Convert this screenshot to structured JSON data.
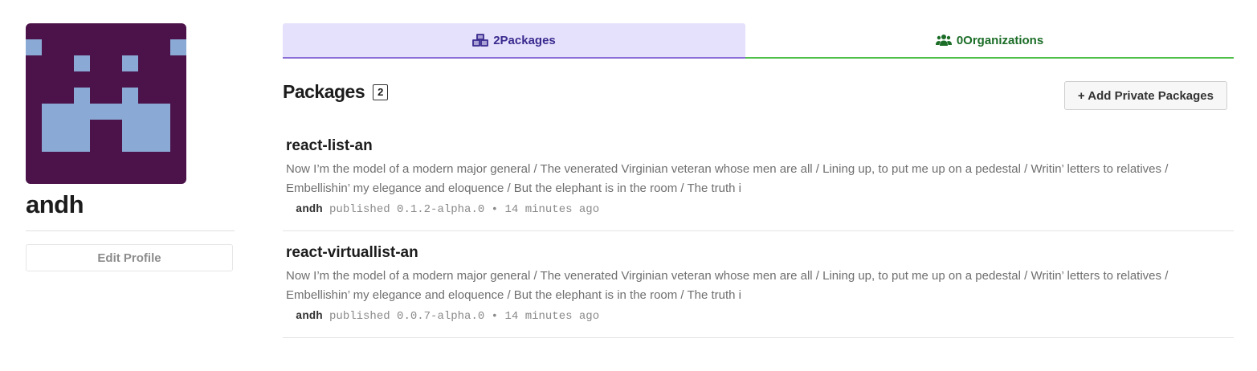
{
  "profile": {
    "username": "andh",
    "edit_label": "Edit Profile",
    "avatar_colors": {
      "background": "#4b1349",
      "foreground": "#8aa9d4"
    }
  },
  "tabs": [
    {
      "count": "2",
      "label": "Packages",
      "icon": "cubes-icon",
      "color": "#3a2a8f"
    },
    {
      "count": "0",
      "label": "Organizations",
      "icon": "users-icon",
      "color": "#1b6d27"
    }
  ],
  "packages_section": {
    "title": "Packages",
    "count": "2",
    "add_button": "+ Add Private Packages"
  },
  "packages": [
    {
      "name": "react-list-an",
      "description": "Now I’m the model of a modern major general / The venerated Virginian veteran whose men are all / Lining up, to put me up on a pedestal / Writin’ letters to relatives / Embellishin’ my elegance and eloquence / But the elephant is in the room / The truth i",
      "publisher": "andh",
      "published_text": "published",
      "version": "0.1.2-alpha.0",
      "separator": "•",
      "time": "14 minutes ago"
    },
    {
      "name": "react-virtuallist-an",
      "description": "Now I’m the model of a modern major general / The venerated Virginian veteran whose men are all / Lining up, to put me up on a pedestal / Writin’ letters to relatives / Embellishin’ my elegance and eloquence / But the elephant is in the room / The truth i",
      "publisher": "andh",
      "published_text": "published",
      "version": "0.0.7-alpha.0",
      "separator": "•",
      "time": "14 minutes ago"
    }
  ]
}
